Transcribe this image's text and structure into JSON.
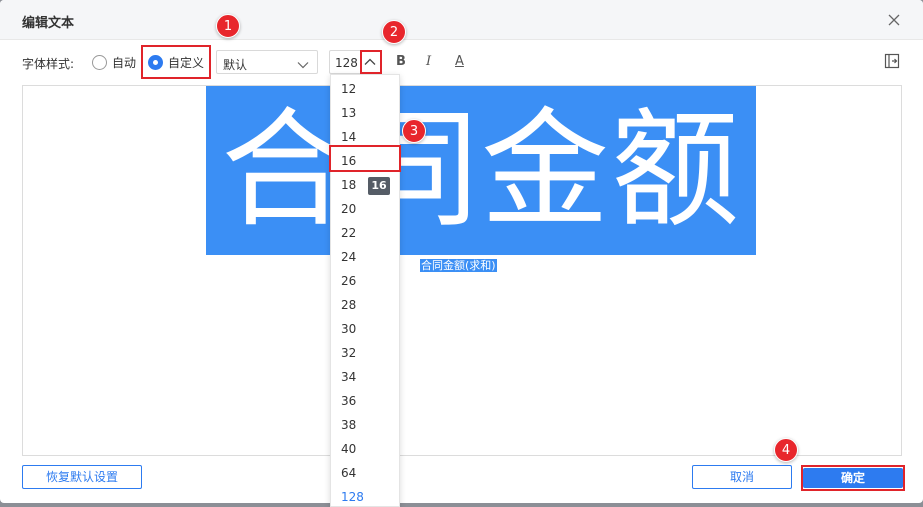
{
  "dialog": {
    "title": "编辑文本"
  },
  "toolbar": {
    "font_style_label": "字体样式:",
    "radio_auto": "自动",
    "radio_custom": "自定义",
    "font_family_value": "默认",
    "font_size_value": "128",
    "bold_glyph": "B",
    "italic_glyph": "I",
    "underline_glyph": "A"
  },
  "editor": {
    "main_text": "合同金额",
    "sub_text": "合同金额(求和)"
  },
  "dropdown": {
    "options": [
      "12",
      "13",
      "14",
      "16",
      "18",
      "20",
      "22",
      "24",
      "26",
      "28",
      "30",
      "32",
      "34",
      "36",
      "38",
      "40",
      "64",
      "128"
    ],
    "selected": "128",
    "hover_tooltip": "16"
  },
  "footer": {
    "reset_label": "恢复默认设置",
    "cancel_label": "取消",
    "ok_label": "确定"
  },
  "annotations": [
    "1",
    "2",
    "3",
    "4"
  ],
  "colors": {
    "accent": "#2d7bf0",
    "highlight": "#e0242a",
    "selection": "#3b8ff5"
  }
}
